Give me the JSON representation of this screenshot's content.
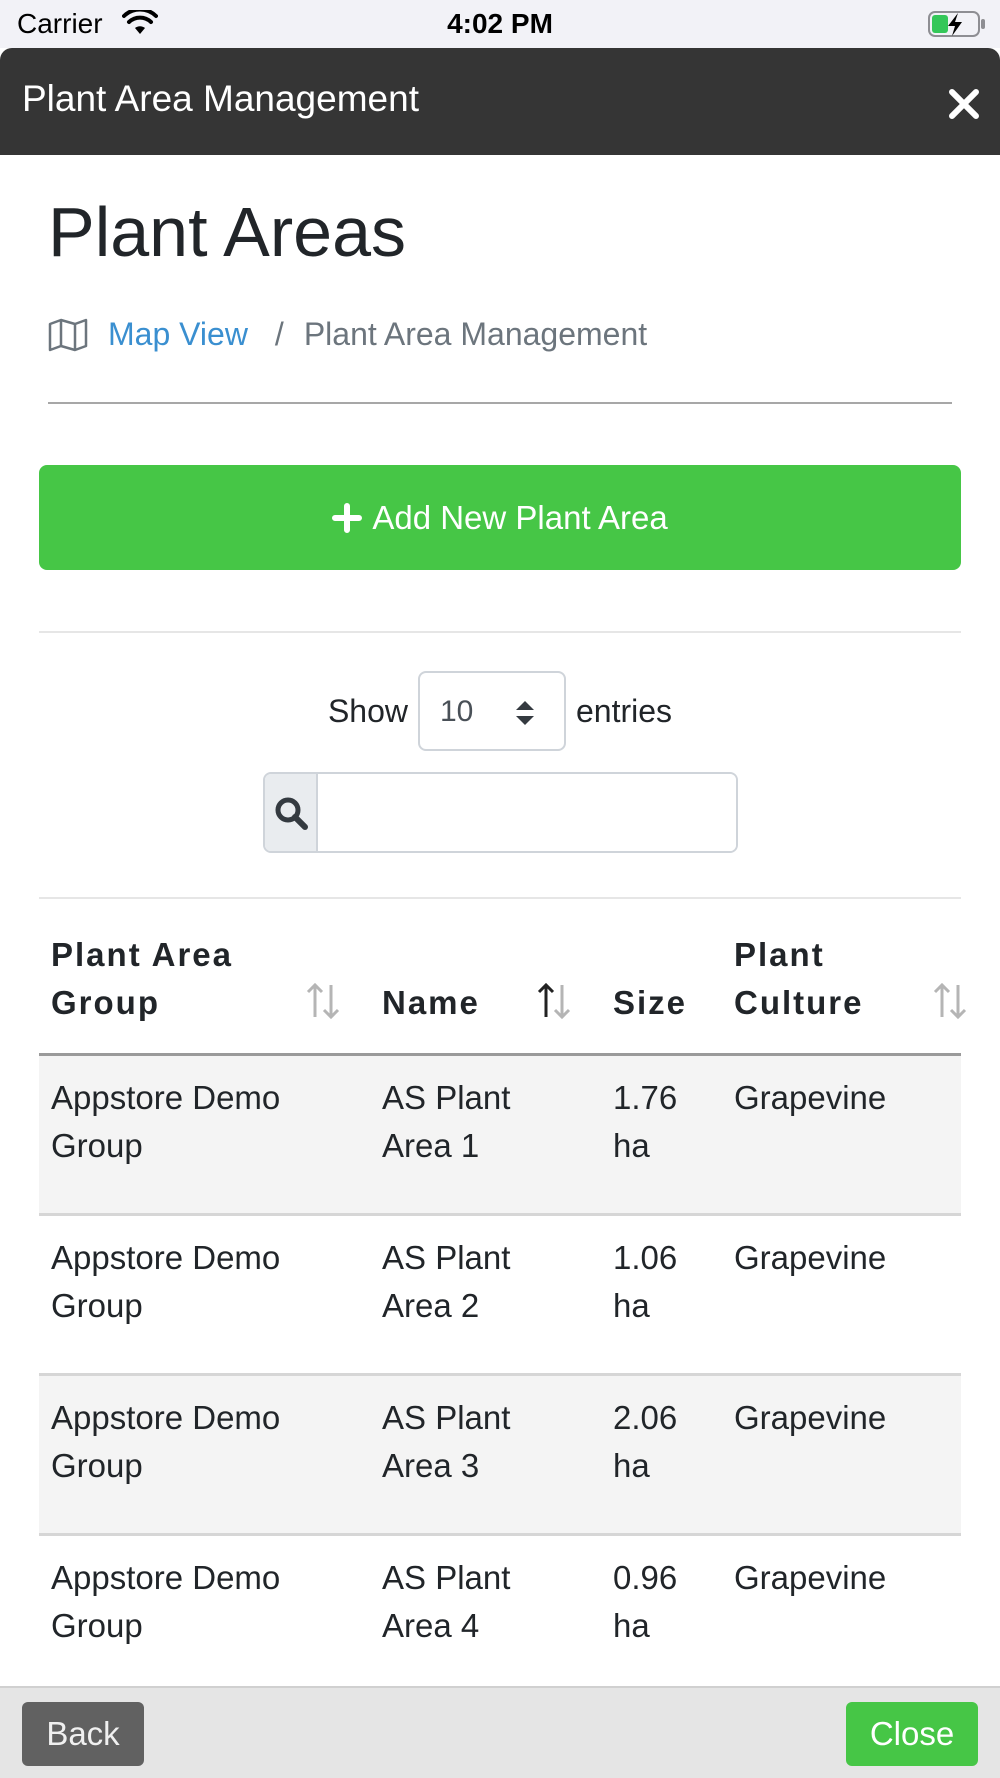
{
  "status_bar": {
    "carrier": "Carrier",
    "time": "4:02 PM",
    "wifi_icon": "wifi-icon",
    "battery_icon": "battery-charging-icon"
  },
  "header": {
    "title": "Plant Area Management",
    "close_icon": "close-icon"
  },
  "page": {
    "title": "Plant Areas"
  },
  "breadcrumb": {
    "icon": "map-icon",
    "link": "Map View",
    "separator": "/",
    "current": "Plant Area Management"
  },
  "actions": {
    "add_label": "Add New Plant Area",
    "add_color": "#46c646"
  },
  "entries": {
    "show_label": "Show",
    "value": "10",
    "entries_label": "entries"
  },
  "search": {
    "placeholder": "",
    "value": ""
  },
  "table": {
    "columns": [
      {
        "label": "Plant Area\nGroup"
      },
      {
        "label": "Name"
      },
      {
        "label": "Size"
      },
      {
        "label": "Plant\nCulture"
      }
    ],
    "rows": [
      {
        "group": "Appstore Demo Group",
        "name": "AS Plant Area 1",
        "size": "1.76 ha",
        "culture": "Grapevine"
      },
      {
        "group": "Appstore Demo Group",
        "name": "AS Plant Area 2",
        "size": "1.06 ha",
        "culture": "Grapevine"
      },
      {
        "group": "Appstore Demo Group",
        "name": "AS Plant Area 3",
        "size": "2.06 ha",
        "culture": "Grapevine"
      },
      {
        "group": "Appstore Demo Group",
        "name": "AS Plant Area 4",
        "size": "0.96 ha",
        "culture": "Grapevine"
      }
    ]
  },
  "footer": {
    "back_label": "Back",
    "close_label": "Close"
  }
}
